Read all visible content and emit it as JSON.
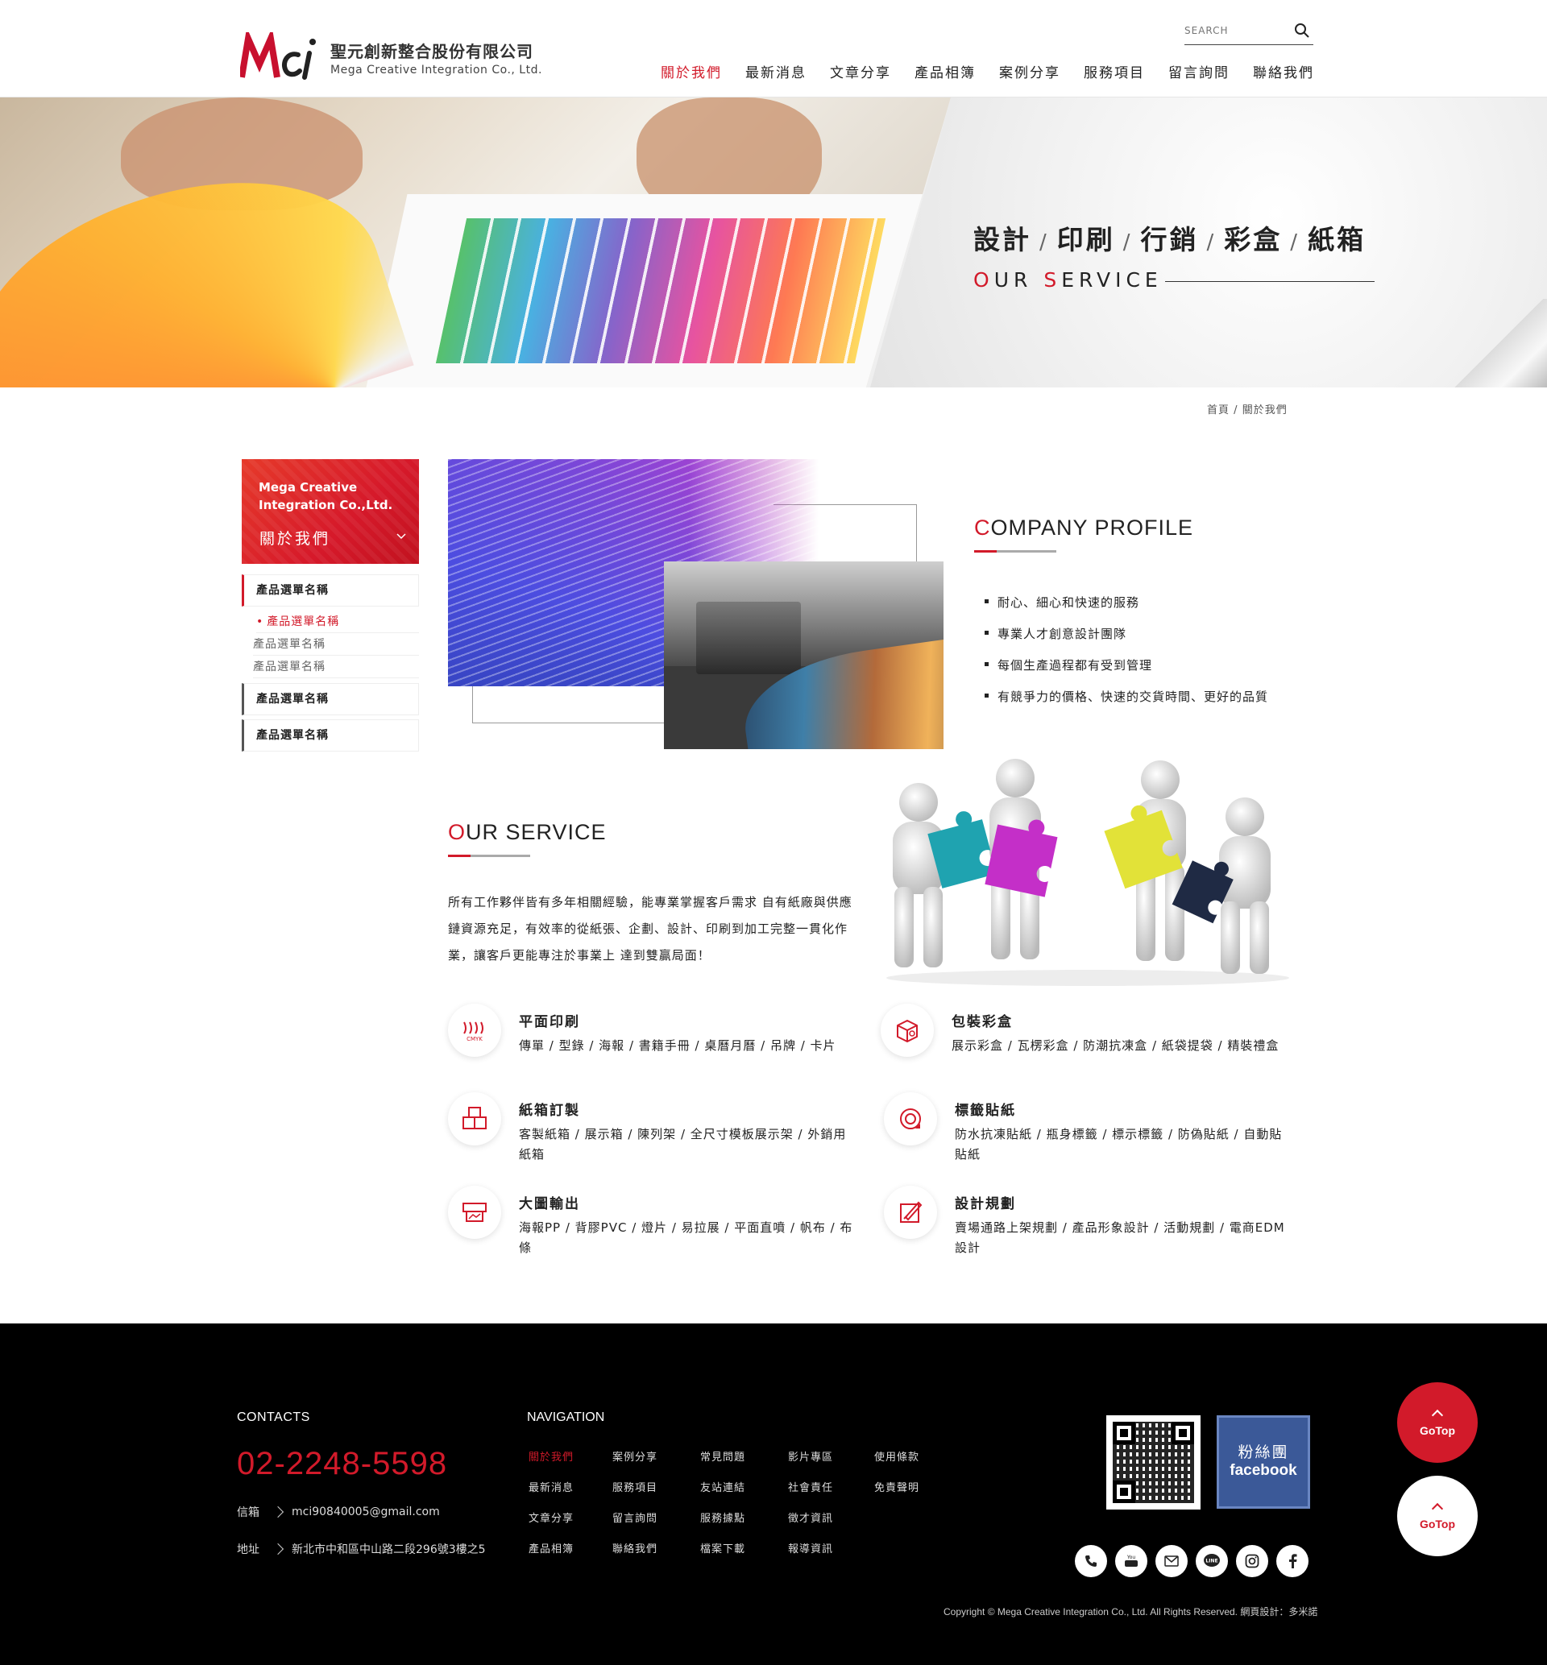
{
  "header": {
    "logo_mark": "Mci",
    "company_zh": "聖元創新整合股份有限公司",
    "company_en": "Mega Creative Integration Co., Ltd.",
    "search_placeholder": "SEARCH",
    "nav": [
      "關於我們",
      "最新消息",
      "文章分享",
      "產品相簿",
      "案例分享",
      "服務項目",
      "留言詢問",
      "聯絡我們"
    ]
  },
  "banner": {
    "t1": "設計",
    "t2": "印刷",
    "t3": "行銷",
    "t4": "彩盒",
    "t5": "紙箱",
    "sep": "/",
    "sub_o": "O",
    "sub_ur": "UR ",
    "sub_s": "S",
    "sub_ervice": "ERVICE"
  },
  "breadcrumb": {
    "home": "首頁",
    "sep": "/",
    "current": "關於我們"
  },
  "sidebar": {
    "en_line1": "Mega Creative",
    "en_line2": "Integration Co.,Ltd.",
    "zh": "關於我們",
    "items": [
      {
        "label": "產品選單名稱"
      },
      {
        "label": "產品選單名稱"
      },
      {
        "label": "產品選單名稱"
      }
    ],
    "subitems": [
      "產品選單名稱",
      "產品選單名稱",
      "產品選單名稱"
    ]
  },
  "profile": {
    "title_first": "C",
    "title_rest": "OMPANY PROFILE",
    "points": [
      "耐心、細心和快速的服務",
      "專業人才創意設計團隊",
      "每個生產過程都有受到管理",
      "有競爭力的價格、快速的交貨時間、更好的品質"
    ]
  },
  "service": {
    "title_first": "O",
    "title_rest": "UR SERVICE",
    "text": "所有工作夥伴皆有多年相關經驗，能專業掌握客戶需求 自有紙廠與供應鏈資源充足，有效率的從紙張、企劃、設計、印刷到加工完整一貫化作業，讓客戶更能專注於事業上 達到雙贏局面！",
    "items": [
      {
        "title": "平面印刷",
        "desc": "傳單 / 型錄 / 海報 / 書籍手冊 / 桌曆月曆 / 吊牌 / 卡片",
        "icon": "cmyk-print-icon"
      },
      {
        "title": "包裝彩盒",
        "desc": "展示彩盒 / 瓦楞彩盒 / 防潮抗凍盒 / 紙袋提袋 / 精裝禮盒",
        "icon": "package-box-icon"
      },
      {
        "title": "紙箱訂製",
        "desc": "客製紙箱 / 展示箱 / 陳列架 / 全尺寸模板展示架 / 外銷用紙箱",
        "icon": "carton-boxes-icon"
      },
      {
        "title": "標籤貼紙",
        "desc": "防水抗凍貼紙 / 瓶身標籤 / 標示標籤 / 防偽貼紙 / 自動貼貼紙",
        "icon": "label-sticker-icon"
      },
      {
        "title": "大圖輸出",
        "desc": "海報PP / 背膠PVC / 燈片 / 易拉展 / 平面直噴 / 帆布 / 布條",
        "icon": "large-print-icon"
      },
      {
        "title": "設計規劃",
        "desc": "賣場通路上架規劃 / 產品形象設計 / 活動規劃 / 電商EDM設計",
        "icon": "design-plan-icon"
      }
    ]
  },
  "footer": {
    "contacts_title": "CONTACTS",
    "phone": "02-2248-5598",
    "email_label": "信箱",
    "email": "mci90840005@gmail.com",
    "address_label": "地址",
    "address": "新北市中和區中山路二段296號3樓之5",
    "nav_title": "NAVIGATION",
    "nav_cols": [
      [
        "關於我們",
        "最新消息",
        "文章分享",
        "產品相簿"
      ],
      [
        "案例分享",
        "服務項目",
        "留言詢問",
        "聯絡我們"
      ],
      [
        "常見問題",
        "友站連結",
        "服務據點",
        "檔案下載"
      ],
      [
        "影片專區",
        "社會責任",
        "徵才資訊",
        "報導資訊"
      ],
      [
        "使用條款",
        "免責聲明"
      ]
    ],
    "fb_line1": "粉絲團",
    "fb_line2": "facebook",
    "socials": [
      "phone-icon",
      "youtube-icon",
      "mail-icon",
      "line-icon",
      "instagram-icon",
      "facebook-icon"
    ],
    "copyright": "Copyright © Mega Creative Integration Co., Ltd. All Rights Reserved. 網頁設計：多米諾"
  },
  "gotop_label": "GoTop",
  "colors": {
    "accent": "#d21a2a",
    "footer_bg": "#000000"
  }
}
